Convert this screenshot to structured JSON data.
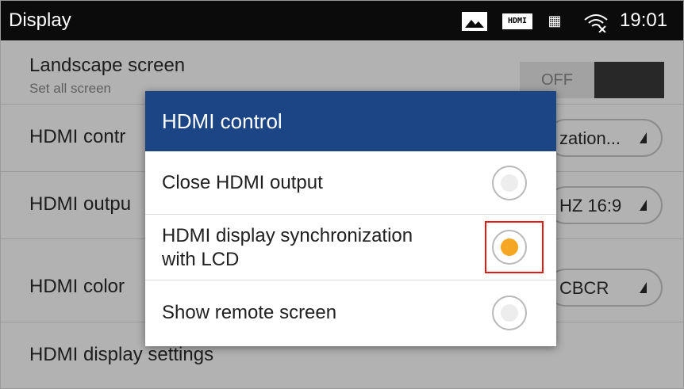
{
  "status_bar": {
    "title": "Display",
    "icons": [
      "image-icon",
      "hdmi-icon",
      "calendar-icon",
      "wifi-icon"
    ],
    "hdmi_label": "HDMI",
    "time": "19:01"
  },
  "settings": {
    "landscape": {
      "label": "Landscape screen",
      "subtitle": "Set all screen",
      "toggle": "OFF"
    },
    "hdmi_control": {
      "label": "HDMI contr",
      "value": "zation..."
    },
    "hdmi_output": {
      "label": "HDMI outpu",
      "value": "HZ 16:9"
    },
    "hdmi_color": {
      "label": "HDMI color",
      "value": "CBCR"
    },
    "hdmi_display_settings": {
      "label": "HDMI display settings"
    }
  },
  "dialog": {
    "title": "HDMI control",
    "options": [
      {
        "line1": "Close HDMI output",
        "line2": "",
        "selected": false
      },
      {
        "line1": "HDMI display synchronization",
        "line2": "with LCD",
        "selected": true
      },
      {
        "line1": "Show remote screen",
        "line2": "",
        "selected": false
      }
    ]
  },
  "colors": {
    "dialog_header": "#1c4585",
    "radio_selected": "#f5a623",
    "highlight_border": "#e31b1b"
  }
}
